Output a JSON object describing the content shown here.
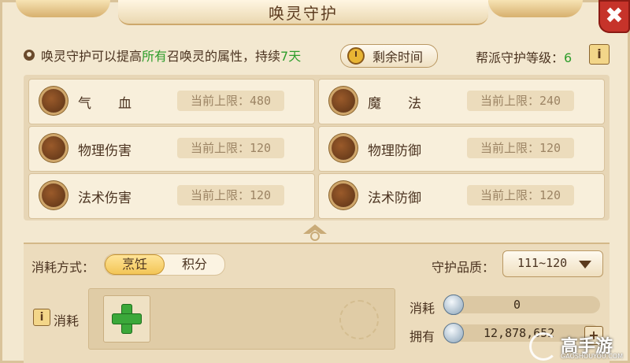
{
  "window": {
    "title": "唤灵守护",
    "close_label": "✖"
  },
  "intro": {
    "prefix": "唤灵守护可以提高",
    "highlight": "所有",
    "middle": "召唤灵的属性，持续",
    "days": "7天",
    "remain_button": "剩余时间"
  },
  "guild_guard": {
    "label": "帮派守护等级：",
    "level": "6",
    "info_label": "i"
  },
  "attributes": [
    {
      "name": "气　　血",
      "limit": "当前上限：480"
    },
    {
      "name": "魔　　法",
      "limit": "当前上限：240"
    },
    {
      "name": "物理伤害",
      "limit": "当前上限：120"
    },
    {
      "name": "物理防御",
      "limit": "当前上限：120"
    },
    {
      "name": "法术伤害",
      "limit": "当前上限：120"
    },
    {
      "name": "法术防御",
      "limit": "当前上限：120"
    }
  ],
  "cost_mode": {
    "label": "消耗方式：",
    "options": [
      "烹饪",
      "积分"
    ],
    "selected": "烹饪"
  },
  "quality": {
    "label": "守护品质：",
    "value": "111~120"
  },
  "consume_section": {
    "info_label": "i",
    "label": "消耗"
  },
  "resources": {
    "consume_label": "消耗",
    "consume_value": "0",
    "own_label": "拥有",
    "own_value": "12,878,652",
    "add_label": "+"
  },
  "watermark": {
    "brand": "高手游",
    "url": "GAOSHOUYOU.COM"
  },
  "colors": {
    "panel_bg": "#f3e8d0",
    "accent_green": "#2e9d2b",
    "close_red": "#c6332a",
    "toggle_active": "#f2c454"
  }
}
